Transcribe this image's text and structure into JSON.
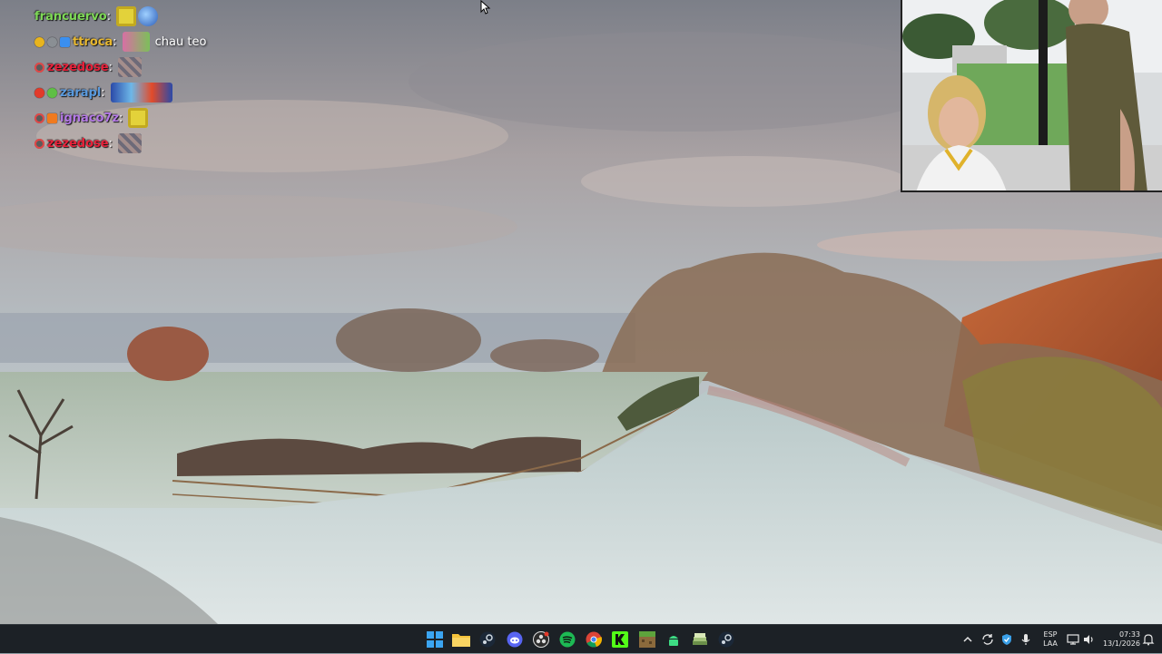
{
  "chat": {
    "messages": [
      {
        "user": "francuervo",
        "color": "#7ed957",
        "badges": [],
        "emotes": [
          "sponge-face-emote",
          "blue-ball-emote"
        ],
        "text": ""
      },
      {
        "user": "ttroca",
        "color": "#e8b830",
        "badges": [
          "gold-badge",
          "gray-badge",
          "blue-cube-badge"
        ],
        "emotes": [
          "pink-frog-emote"
        ],
        "text": "chau teo"
      },
      {
        "user": "zezedose",
        "color": "#e8213a",
        "badges": [
          "skull-badge"
        ],
        "emotes": [
          "pixel-cat-emote"
        ],
        "text": ""
      },
      {
        "user": "zarapl",
        "color": "#5a9be0",
        "badges": [
          "red-badge",
          "green-badge"
        ],
        "emotes": [
          "cars-banner-emote"
        ],
        "text": ""
      },
      {
        "user": "ignaco7z",
        "color": "#b479e6",
        "badges": [
          "skull-badge",
          "orange-badge"
        ],
        "emotes": [
          "sponge-face-emote"
        ],
        "text": ""
      },
      {
        "user": "zezedose",
        "color": "#e8213a",
        "badges": [
          "skull-badge"
        ],
        "emotes": [
          "pixel-cat-emote"
        ],
        "text": ""
      }
    ]
  },
  "taskbar": {
    "apps": [
      "windows-start-icon",
      "file-explorer-icon",
      "steam-icon",
      "discord-icon",
      "obs-icon",
      "spotify-icon",
      "chrome-icon",
      "kick-icon",
      "minecraft-icon",
      "android-icon",
      "stack-app-icon",
      "steam-icon"
    ],
    "tray": {
      "language_top": "ESP",
      "language_bottom": "LAA",
      "time": "07:33",
      "date": "13/1/2026"
    }
  }
}
